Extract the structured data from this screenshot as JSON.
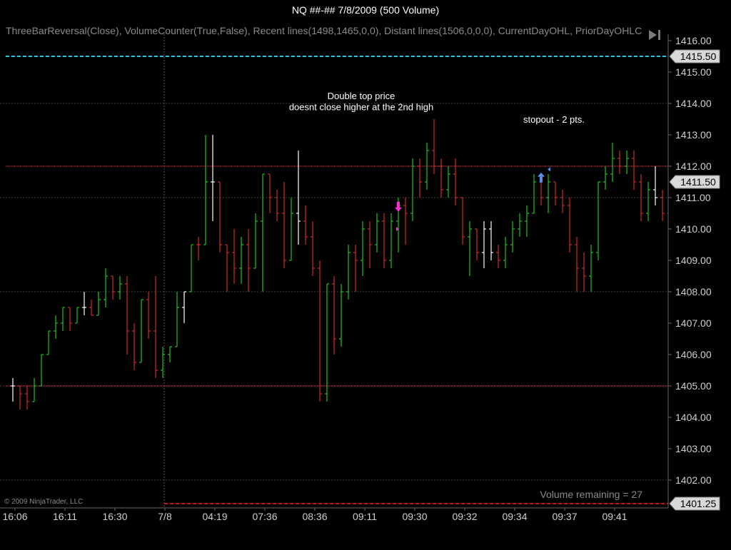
{
  "window": {
    "title": "NQ ##-##  7/8/2009 (500 Volume)"
  },
  "indicators_line": "ThreeBarReversal(Close),  VolumeCounter(True,False),  Recent  lines(1498,1465,0,0),  Distant  lines(1506,0,0,0),  CurrentDayOHL,  PriorDayOHLC",
  "copyright": "© 2009 NinjaTrader, LLC",
  "volume_remaining": "Volume remaining = 27",
  "colors": {
    "up": "#22c322",
    "down": "#d22a2a",
    "doji": "#ffffff",
    "cyan_line": "#25c4d4",
    "pink_line": "#d4546c",
    "red_dash": "#b81c1c",
    "grid": "#3c3c3c",
    "magenta": "#ff2cd2",
    "blue": "#5b8fe3"
  },
  "chart_data": {
    "type": "bar",
    "subtype": "ohlc",
    "title": "NQ ##-##  7/8/2009 (500 Volume)",
    "ylim": [
      1401.25,
      1416.0
    ],
    "y_ticks": [
      "1416.00",
      "1415.00",
      "1414.00",
      "1413.00",
      "1412.00",
      "1411.00",
      "1410.00",
      "1409.00",
      "1408.00",
      "1407.00",
      "1406.00",
      "1405.00",
      "1404.00",
      "1403.00",
      "1402.00"
    ],
    "x_tick_labels": [
      "16:06",
      "16:11",
      "16:30",
      "7/8",
      "04:19",
      "07:36",
      "08:36",
      "09:11",
      "09:30",
      "09:32",
      "09:34",
      "09:37",
      "09:41"
    ],
    "x_tick_bar_index": [
      0,
      7,
      14,
      21,
      28,
      35,
      42,
      49,
      56,
      63,
      70,
      77,
      84
    ],
    "session_break_index": 21,
    "grid": true,
    "bars": [
      {
        "o": 1405.0,
        "h": 1405.25,
        "l": 1404.5,
        "c": 1405.0,
        "d": 0
      },
      {
        "o": 1405.0,
        "h": 1405.0,
        "l": 1404.25,
        "c": 1404.75,
        "d": -1
      },
      {
        "o": 1404.75,
        "h": 1405.0,
        "l": 1404.25,
        "c": 1404.5,
        "d": -1
      },
      {
        "o": 1404.5,
        "h": 1405.25,
        "l": 1404.5,
        "c": 1405.0,
        "d": 1
      },
      {
        "o": 1405.0,
        "h": 1406.0,
        "l": 1405.0,
        "c": 1406.0,
        "d": 1
      },
      {
        "o": 1406.0,
        "h": 1406.75,
        "l": 1406.0,
        "c": 1406.75,
        "d": 1
      },
      {
        "o": 1406.75,
        "h": 1407.25,
        "l": 1406.5,
        "c": 1407.0,
        "d": 1
      },
      {
        "o": 1407.0,
        "h": 1407.5,
        "l": 1406.75,
        "c": 1407.5,
        "d": 1
      },
      {
        "o": 1407.5,
        "h": 1407.5,
        "l": 1406.75,
        "c": 1407.0,
        "d": -1
      },
      {
        "o": 1407.0,
        "h": 1407.5,
        "l": 1407.0,
        "c": 1407.5,
        "d": 1
      },
      {
        "o": 1407.5,
        "h": 1408.0,
        "l": 1407.25,
        "c": 1407.5,
        "d": 0
      },
      {
        "o": 1407.5,
        "h": 1407.75,
        "l": 1407.25,
        "c": 1407.25,
        "d": -1
      },
      {
        "o": 1407.25,
        "h": 1408.0,
        "l": 1407.25,
        "c": 1407.75,
        "d": 1
      },
      {
        "o": 1407.75,
        "h": 1408.75,
        "l": 1407.5,
        "c": 1408.5,
        "d": 1
      },
      {
        "o": 1408.5,
        "h": 1408.5,
        "l": 1407.75,
        "c": 1408.0,
        "d": -1
      },
      {
        "o": 1408.0,
        "h": 1408.5,
        "l": 1407.75,
        "c": 1408.25,
        "d": 1
      },
      {
        "o": 1408.25,
        "h": 1408.5,
        "l": 1406.0,
        "c": 1406.75,
        "d": -1
      },
      {
        "o": 1406.75,
        "h": 1407.0,
        "l": 1405.5,
        "c": 1405.75,
        "d": -1
      },
      {
        "o": 1405.75,
        "h": 1407.75,
        "l": 1405.75,
        "c": 1407.75,
        "d": 1
      },
      {
        "o": 1407.75,
        "h": 1408.0,
        "l": 1406.5,
        "c": 1406.75,
        "d": -1
      },
      {
        "o": 1406.75,
        "h": 1408.5,
        "l": 1405.25,
        "c": 1405.5,
        "d": -1
      },
      {
        "o": 1405.5,
        "h": 1406.25,
        "l": 1405.25,
        "c": 1406.0,
        "d": 1
      },
      {
        "o": 1406.0,
        "h": 1406.25,
        "l": 1405.75,
        "c": 1406.25,
        "d": 1
      },
      {
        "o": 1406.25,
        "h": 1408.0,
        "l": 1406.25,
        "c": 1407.5,
        "d": 1
      },
      {
        "o": 1407.5,
        "h": 1408.0,
        "l": 1407.0,
        "c": 1408.0,
        "d": 0
      },
      {
        "o": 1408.0,
        "h": 1409.5,
        "l": 1408.0,
        "c": 1409.5,
        "d": 1
      },
      {
        "o": 1409.5,
        "h": 1409.75,
        "l": 1409.0,
        "c": 1409.5,
        "d": -1
      },
      {
        "o": 1409.5,
        "h": 1413.0,
        "l": 1409.5,
        "c": 1411.5,
        "d": 1
      },
      {
        "o": 1411.5,
        "h": 1413.0,
        "l": 1410.25,
        "c": 1411.5,
        "d": 0
      },
      {
        "o": 1411.5,
        "h": 1411.5,
        "l": 1409.25,
        "c": 1409.5,
        "d": -1
      },
      {
        "o": 1409.5,
        "h": 1409.5,
        "l": 1408.0,
        "c": 1409.25,
        "d": -1
      },
      {
        "o": 1409.25,
        "h": 1410.0,
        "l": 1408.25,
        "c": 1408.75,
        "d": -1
      },
      {
        "o": 1408.75,
        "h": 1409.75,
        "l": 1408.25,
        "c": 1409.5,
        "d": 1
      },
      {
        "o": 1409.5,
        "h": 1410.0,
        "l": 1408.0,
        "c": 1408.75,
        "d": -1
      },
      {
        "o": 1408.75,
        "h": 1410.5,
        "l": 1408.75,
        "c": 1410.25,
        "d": 1
      },
      {
        "o": 1410.25,
        "h": 1411.75,
        "l": 1408.0,
        "c": 1411.75,
        "d": 1
      },
      {
        "o": 1411.75,
        "h": 1411.75,
        "l": 1410.5,
        "c": 1411.0,
        "d": -1
      },
      {
        "o": 1411.0,
        "h": 1411.25,
        "l": 1410.25,
        "c": 1410.5,
        "d": -1
      },
      {
        "o": 1410.5,
        "h": 1411.5,
        "l": 1408.75,
        "c": 1409.0,
        "d": -1
      },
      {
        "o": 1409.0,
        "h": 1411.0,
        "l": 1409.0,
        "c": 1410.5,
        "d": 1
      },
      {
        "o": 1410.5,
        "h": 1412.5,
        "l": 1409.5,
        "c": 1410.25,
        "d": 0
      },
      {
        "o": 1410.25,
        "h": 1410.75,
        "l": 1409.5,
        "c": 1409.75,
        "d": -1
      },
      {
        "o": 1409.75,
        "h": 1410.25,
        "l": 1408.5,
        "c": 1408.75,
        "d": -1
      },
      {
        "o": 1408.75,
        "h": 1409.0,
        "l": 1404.5,
        "c": 1404.75,
        "d": -1
      },
      {
        "o": 1404.75,
        "h": 1408.25,
        "l": 1404.5,
        "c": 1408.25,
        "d": 1
      },
      {
        "o": 1408.25,
        "h": 1408.5,
        "l": 1406.0,
        "c": 1406.5,
        "d": -1
      },
      {
        "o": 1406.5,
        "h": 1408.25,
        "l": 1406.25,
        "c": 1408.0,
        "d": 1
      },
      {
        "o": 1408.0,
        "h": 1409.5,
        "l": 1407.75,
        "c": 1409.25,
        "d": 1
      },
      {
        "o": 1409.25,
        "h": 1409.5,
        "l": 1408.0,
        "c": 1409.0,
        "d": -1
      },
      {
        "o": 1409.0,
        "h": 1410.25,
        "l": 1408.5,
        "c": 1410.0,
        "d": 1
      },
      {
        "o": 1410.0,
        "h": 1410.25,
        "l": 1408.75,
        "c": 1409.5,
        "d": -1
      },
      {
        "o": 1409.5,
        "h": 1410.5,
        "l": 1409.25,
        "c": 1410.25,
        "d": 1
      },
      {
        "o": 1410.25,
        "h": 1410.5,
        "l": 1408.75,
        "c": 1409.0,
        "d": -1
      },
      {
        "o": 1409.0,
        "h": 1410.5,
        "l": 1408.75,
        "c": 1410.25,
        "d": 1
      },
      {
        "o": 1410.25,
        "h": 1411.0,
        "l": 1409.25,
        "c": 1410.75,
        "d": 1
      },
      {
        "o": 1410.75,
        "h": 1411.0,
        "l": 1409.5,
        "c": 1410.5,
        "d": -1
      },
      {
        "o": 1410.5,
        "h": 1412.25,
        "l": 1410.25,
        "c": 1412.0,
        "d": 1
      },
      {
        "o": 1412.0,
        "h": 1412.25,
        "l": 1411.0,
        "c": 1411.5,
        "d": -1
      },
      {
        "o": 1411.5,
        "h": 1412.75,
        "l": 1411.25,
        "c": 1412.5,
        "d": 1
      },
      {
        "o": 1412.5,
        "h": 1413.5,
        "l": 1411.75,
        "c": 1412.0,
        "d": -1
      },
      {
        "o": 1412.0,
        "h": 1412.25,
        "l": 1411.0,
        "c": 1411.25,
        "d": -1
      },
      {
        "o": 1411.25,
        "h": 1412.0,
        "l": 1411.0,
        "c": 1411.75,
        "d": 1
      },
      {
        "o": 1411.75,
        "h": 1412.25,
        "l": 1410.75,
        "c": 1411.0,
        "d": -1
      },
      {
        "o": 1411.0,
        "h": 1411.0,
        "l": 1409.5,
        "c": 1409.75,
        "d": -1
      },
      {
        "o": 1409.75,
        "h": 1410.25,
        "l": 1408.5,
        "c": 1410.0,
        "d": 1
      },
      {
        "o": 1410.0,
        "h": 1410.0,
        "l": 1409.0,
        "c": 1409.25,
        "d": -1
      },
      {
        "o": 1409.25,
        "h": 1410.25,
        "l": 1408.75,
        "c": 1410.0,
        "d": 0
      },
      {
        "o": 1410.0,
        "h": 1410.25,
        "l": 1409.0,
        "c": 1409.25,
        "d": 0
      },
      {
        "o": 1409.25,
        "h": 1409.5,
        "l": 1408.75,
        "c": 1409.0,
        "d": -1
      },
      {
        "o": 1409.0,
        "h": 1409.75,
        "l": 1408.75,
        "c": 1409.5,
        "d": 1
      },
      {
        "o": 1409.5,
        "h": 1410.25,
        "l": 1409.25,
        "c": 1410.0,
        "d": 1
      },
      {
        "o": 1410.0,
        "h": 1410.5,
        "l": 1409.75,
        "c": 1410.25,
        "d": 1
      },
      {
        "o": 1410.25,
        "h": 1410.75,
        "l": 1409.75,
        "c": 1410.5,
        "d": 1
      },
      {
        "o": 1410.5,
        "h": 1411.75,
        "l": 1410.5,
        "c": 1411.5,
        "d": 1
      },
      {
        "o": 1411.5,
        "h": 1411.75,
        "l": 1410.75,
        "c": 1411.0,
        "d": -1
      },
      {
        "o": 1411.0,
        "h": 1411.75,
        "l": 1410.5,
        "c": 1411.5,
        "d": 1
      },
      {
        "o": 1411.5,
        "h": 1411.5,
        "l": 1410.75,
        "c": 1411.0,
        "d": -1
      },
      {
        "o": 1411.0,
        "h": 1411.25,
        "l": 1410.5,
        "c": 1410.75,
        "d": -1
      },
      {
        "o": 1410.75,
        "h": 1411.0,
        "l": 1409.25,
        "c": 1409.5,
        "d": -1
      },
      {
        "o": 1409.5,
        "h": 1409.75,
        "l": 1408.0,
        "c": 1408.75,
        "d": -1
      },
      {
        "o": 1408.75,
        "h": 1409.25,
        "l": 1408.0,
        "c": 1408.5,
        "d": -1
      },
      {
        "o": 1408.5,
        "h": 1409.5,
        "l": 1408.0,
        "c": 1409.25,
        "d": 1
      },
      {
        "o": 1409.25,
        "h": 1411.5,
        "l": 1409.0,
        "c": 1411.5,
        "d": 1
      },
      {
        "o": 1411.5,
        "h": 1412.0,
        "l": 1411.25,
        "c": 1411.75,
        "d": 1
      },
      {
        "o": 1411.75,
        "h": 1412.75,
        "l": 1411.5,
        "c": 1412.25,
        "d": 1
      },
      {
        "o": 1412.25,
        "h": 1412.5,
        "l": 1411.75,
        "c": 1412.0,
        "d": -1
      },
      {
        "o": 1412.0,
        "h": 1412.5,
        "l": 1411.75,
        "c": 1412.25,
        "d": 1
      },
      {
        "o": 1412.25,
        "h": 1412.5,
        "l": 1411.25,
        "c": 1411.5,
        "d": -1
      },
      {
        "o": 1411.5,
        "h": 1411.75,
        "l": 1410.25,
        "c": 1410.5,
        "d": -1
      },
      {
        "o": 1410.5,
        "h": 1411.5,
        "l": 1410.25,
        "c": 1411.25,
        "d": 1
      },
      {
        "o": 1411.25,
        "h": 1412.0,
        "l": 1410.75,
        "c": 1411.0,
        "d": 0
      },
      {
        "o": 1411.0,
        "h": 1411.25,
        "l": 1410.25,
        "c": 1410.5,
        "d": -1
      },
      {
        "o": 1410.5,
        "h": 1410.75,
        "l": 1409.5,
        "c": 1409.75,
        "d": -1
      },
      {
        "o": 1409.75,
        "h": 1410.0,
        "l": 1408.5,
        "c": 1408.75,
        "d": -1
      },
      {
        "o": 1408.75,
        "h": 1409.25,
        "l": 1408.25,
        "c": 1408.5,
        "d": -1
      },
      {
        "o": 1408.5,
        "h": 1409.0,
        "l": 1408.25,
        "c": 1409.0,
        "d": 1
      },
      {
        "o": 1409.0,
        "h": 1410.75,
        "l": 1408.75,
        "c": 1410.5,
        "d": 1
      },
      {
        "o": 1410.5,
        "h": 1411.5,
        "l": 1410.25,
        "c": 1411.25,
        "d": 1
      },
      {
        "o": 1411.25,
        "h": 1411.5,
        "l": 1410.5,
        "c": 1411.0,
        "d": -1
      },
      {
        "o": 1411.0,
        "h": 1411.5,
        "l": 1410.75,
        "c": 1411.25,
        "d": 1
      },
      {
        "o": 1411.25,
        "h": 1412.75,
        "l": 1411.0,
        "c": 1412.5,
        "d": 1
      },
      {
        "o": 1412.5,
        "h": 1413.25,
        "l": 1411.25,
        "c": 1411.5,
        "d": -1
      },
      {
        "o": 1411.5,
        "h": 1412.25,
        "l": 1411.25,
        "c": 1411.5,
        "d": 0
      }
    ],
    "horizontal_lines": [
      {
        "price": 1415.5,
        "style": "dashed",
        "color": "#25c4d4",
        "label": "1415.50"
      },
      {
        "price": 1412.0,
        "style": "dotted",
        "color": "#d4546c"
      },
      {
        "price": 1405.0,
        "style": "dotted",
        "color": "#d4546c"
      },
      {
        "price": 1401.25,
        "style": "dashed",
        "color": "#b81c1c",
        "label": "1401.25",
        "start_bar": 21
      }
    ],
    "last_price_label": "1411.50",
    "annotations": [
      {
        "text": "Double top price",
        "at_bar": 49,
        "price": 1414.25
      },
      {
        "text": "doesnt close higher at the 2nd high",
        "at_bar": 49,
        "price": 1413.9
      },
      {
        "text": "stopout - 2 pts.",
        "at_bar": 76,
        "price": 1413.5
      }
    ],
    "markers": [
      {
        "type": "sell-arrow",
        "bar": 54,
        "price": 1410.55,
        "color": "#ff2cd2"
      },
      {
        "type": "sell-tick",
        "bar": 54,
        "price": 1410.0,
        "color": "#ff2cd2"
      },
      {
        "type": "buy-arrow",
        "bar": 74,
        "price": 1411.8,
        "color": "#5b8fe3"
      },
      {
        "type": "buy-tick",
        "bar": 75,
        "price": 1411.9,
        "color": "#5b8fe3"
      }
    ]
  }
}
